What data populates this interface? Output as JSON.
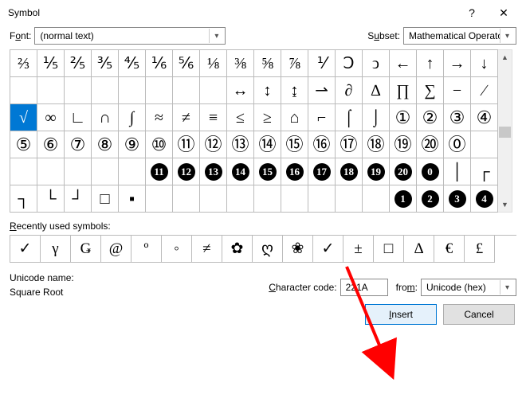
{
  "window": {
    "title": "Symbol",
    "help": "?",
    "close": "✕"
  },
  "font": {
    "label_pre": "F",
    "label_u": "o",
    "label_post": "nt:",
    "value": "(normal text)"
  },
  "subset": {
    "label_pre": "S",
    "label_u": "u",
    "label_post": "bset:",
    "value": "Mathematical Operators"
  },
  "grid": {
    "rows": [
      [
        "⅔",
        "⅕",
        "⅖",
        "⅗",
        "⅘",
        "⅙",
        "⅚",
        "⅛",
        "⅜",
        "⅝",
        "⅞",
        "⅟",
        "Ↄ",
        "ↄ",
        "←",
        "↑",
        "→",
        "↓"
      ],
      [
        "↔",
        "↕",
        "↨",
        "⇀",
        "∂",
        "∆",
        "∏",
        "∑",
        "−",
        "∕"
      ],
      [
        "√",
        "∞",
        "∟",
        "∩",
        "∫",
        "≈",
        "≠",
        "≡",
        "≤",
        "≥",
        "⌂",
        "⌐",
        "⌠",
        "⌡",
        "①",
        "②",
        "③",
        "④"
      ],
      [
        "⑤",
        "⑥",
        "⑦",
        "⑧",
        "⑨",
        "⑩",
        "⑪",
        "⑫",
        "⑬",
        "⑭",
        "⑮",
        "⑯",
        "⑰",
        "⑱",
        "⑲",
        "⑳",
        "⓪"
      ],
      [
        "⓫",
        "⓬",
        "⓭",
        "⓮",
        "⓯",
        "⓰",
        "⓱",
        "⓲",
        "⓳",
        "⓴",
        "⓿",
        "│",
        "┌"
      ],
      [
        "┐",
        "└",
        "┘",
        "□",
        "▪",
        "",
        "",
        "",
        "",
        "",
        "",
        "",
        "",
        "",
        "❶",
        "❷",
        "❸",
        "❹"
      ]
    ],
    "row2_prefix_blanks": 8,
    "row4_prefix": "",
    "row5_prefix_blanks": 5
  },
  "recent": {
    "label_pre": "",
    "label_u": "R",
    "label_post": "ecently used symbols:",
    "items": [
      "✓",
      "γ",
      "Ǥ",
      "@",
      "º",
      "◦",
      "≠",
      "✿",
      "ღ",
      "❀",
      "✓",
      "±",
      "□",
      "∆",
      "€",
      "£"
    ]
  },
  "unicode": {
    "name_label": "Unicode name:",
    "name_value": "Square Root",
    "code_label_pre": "",
    "code_label_u": "C",
    "code_label_post": "haracter code:",
    "code_value": "221A",
    "from_label_pre": "fro",
    "from_label_u": "m",
    "from_label_post": ":",
    "from_value": "Unicode (hex)"
  },
  "buttons": {
    "insert_u": "I",
    "insert_post": "nsert",
    "cancel": "Cancel"
  }
}
